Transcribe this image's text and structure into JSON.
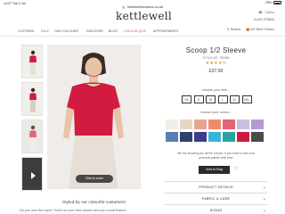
{
  "status_bar": {
    "time": "14:27",
    "date": "Tue 2 Jul",
    "battery": "75%"
  },
  "browser": {
    "url": "kettlewellcolours.co.uk"
  },
  "header": {
    "logo": "kettlewell",
    "call_label": "Call us",
    "phone": "01423 278500"
  },
  "nav": {
    "items": [
      "CLOTHING",
      "SALE",
      "OUR COLOURS",
      "DISCOVER",
      "BLOG",
      "COLOUR QUIZ",
      "APPOINTMENTS"
    ],
    "search_label": "Search",
    "bag_label": "MY BAG",
    "bag_count": "0 items"
  },
  "product": {
    "title": "Scoop 1/2 Sleeve",
    "style_no": "STYLE NO. 780464",
    "stars": "★★★★½",
    "rating": 4.5,
    "price": "£37.00",
    "size_prompt": "choose your size...",
    "sizes": [
      "XS",
      "S",
      "M",
      "L",
      "XL",
      "XXL"
    ],
    "colour_prompt": "choose your colour...",
    "swatches": [
      "#f2ede6",
      "#e8d6c4",
      "#e9a48f",
      "#f08a6e",
      "#e36477",
      "#c7bfe0",
      "#b49ad8",
      "#5a7fb5",
      "#2c4170",
      "#3a3d8c",
      "#36b6d6",
      "#29a2a0",
      "#c81d42",
      "#4b4b4b"
    ],
    "notice_line1": "We are showing you all the colours. If you'd like to see your",
    "notice_line2": "personal palette",
    "notice_link": "click here",
    "add_to_bag": "Add to Bag",
    "accordion": [
      "PRODUCT DETAILS",
      "FABRIC & CARE",
      "SIZING"
    ]
  },
  "media": {
    "video_button": "Click to zoom",
    "styled_title": "Styled by our colourful customers",
    "styled_sub": "Do you own this style? Send us your best photos and you could feature"
  },
  "colors": {
    "accent_pink": "#e04b7a",
    "garment_red": "#d21c3f",
    "dark_button": "#2b2b2b"
  }
}
